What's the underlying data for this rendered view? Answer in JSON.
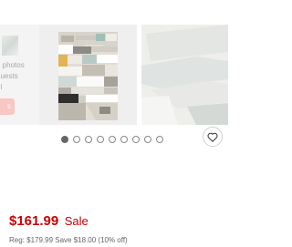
{
  "gallery": {
    "ugc_card": {
      "text_lines": [
        "d photos",
        "guests",
        "ul"
      ],
      "button_label": "s"
    },
    "dots_count": 9,
    "active_dot": 0
  },
  "pricing": {
    "price": "$161.99",
    "sale_label": "Sale",
    "regular_line": "Reg: $179.99 Save $18.00 (10% off)"
  },
  "colors": {
    "price_red": "#cc0000",
    "dot_active": "#666666"
  }
}
